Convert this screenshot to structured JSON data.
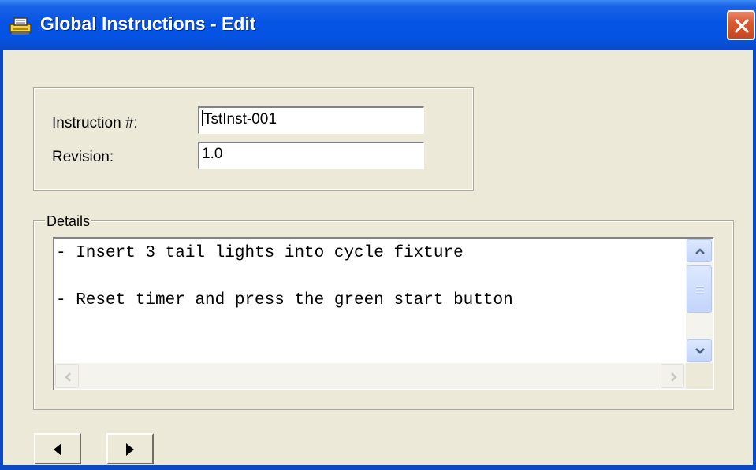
{
  "window": {
    "title": "Global Instructions - Edit",
    "icon": "printer-app-icon",
    "accent_color": "#0654e4",
    "close_color": "#d95a32"
  },
  "header_group": {
    "instruction_label": "Instruction #:",
    "instruction_value": "TstInst-001",
    "revision_label": "Revision:",
    "revision_value": "1.0"
  },
  "details": {
    "legend": "Details",
    "lines": [
      "- Insert 3 tail lights into cycle fixture",
      "",
      "- Reset timer and press the green start button"
    ]
  },
  "navigation": {
    "prev_icon": "triangle-left-icon",
    "next_icon": "triangle-right-icon"
  }
}
